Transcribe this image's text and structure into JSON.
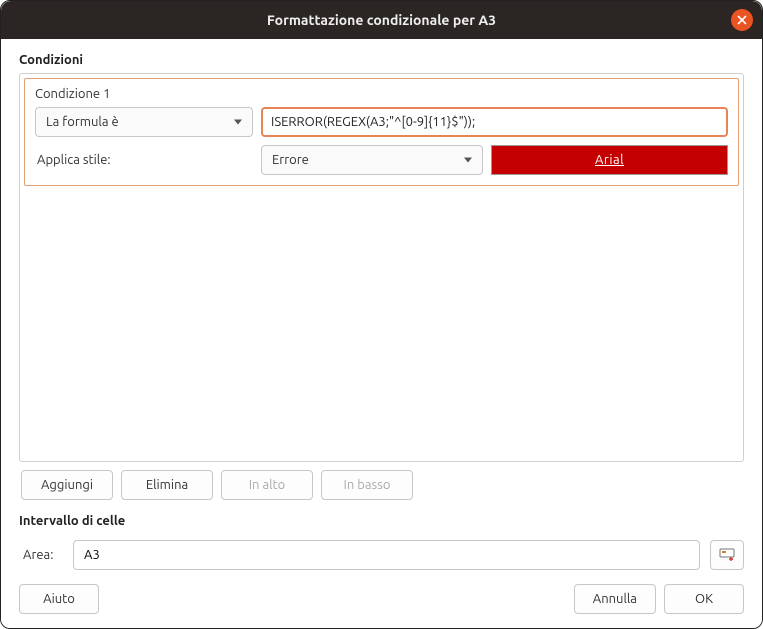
{
  "window": {
    "title": "Formattazione condizionale per A3"
  },
  "sections": {
    "conditions_label": "Condizioni",
    "cell_range_label": "Intervallo di celle"
  },
  "condition": {
    "title": "Condizione 1",
    "type_combo": "La formula è",
    "formula_value": "ISERROR(REGEX(A3;\"^[0-9]{11}$\"));",
    "apply_style_label": "Applica stile:",
    "style_combo": "Errore",
    "preview_text": "Arial"
  },
  "buttons": {
    "add": "Aggiungi",
    "delete": "Elimina",
    "up": "In alto",
    "down": "In basso",
    "help": "Aiuto",
    "cancel": "Annulla",
    "ok": "OK"
  },
  "area": {
    "label": "Area:",
    "value": "A3"
  }
}
